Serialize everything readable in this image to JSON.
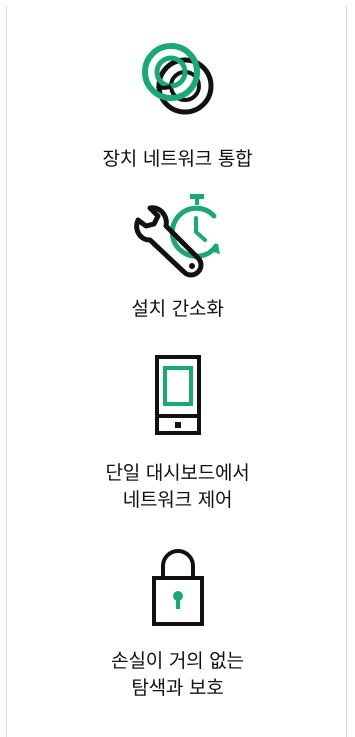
{
  "colors": {
    "accent": "#19a974",
    "ink": "#111111",
    "divider": "#d9d9d9"
  },
  "features": [
    {
      "icon": "linked-rings-icon",
      "lines": [
        "장치 네트워크 통합"
      ]
    },
    {
      "icon": "wrench-timer-icon",
      "lines": [
        "설치 간소화"
      ]
    },
    {
      "icon": "tablet-icon",
      "lines": [
        "단일 대시보드에서",
        "네트워크 제어"
      ]
    },
    {
      "icon": "padlock-icon",
      "lines": [
        "손실이 거의 없는",
        "탐색과 보호"
      ]
    }
  ]
}
